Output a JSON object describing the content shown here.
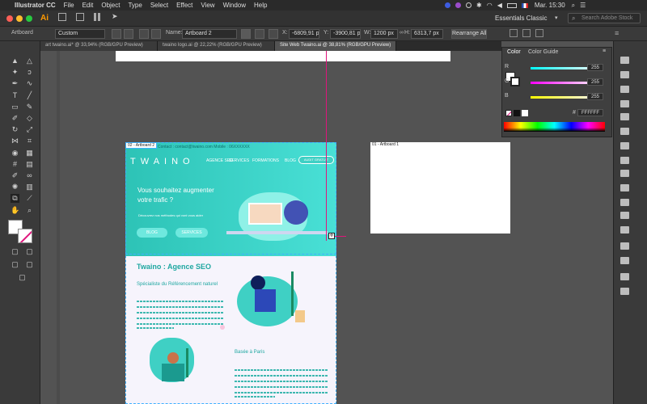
{
  "menubar": {
    "app": "Illustrator CC",
    "items": [
      "File",
      "Edit",
      "Object",
      "Type",
      "Select",
      "Effect",
      "View",
      "Window",
      "Help"
    ],
    "clock": "Mar. 15:30"
  },
  "appbar": {
    "logo": "Ai",
    "workspace": "Essentials Classic",
    "search_placeholder": "Search Adobe Stock"
  },
  "control": {
    "selection": "Artboard",
    "preset": "Custom",
    "name_label": "Name:",
    "name_value": "Artboard 2",
    "x_label": "X:",
    "x": "-6809,91 pt",
    "y_label": "Y:",
    "y": "-3900,81 pt",
    "w_label": "W:",
    "w": "1200 px",
    "h_label": "H:",
    "h": "6313,7 px",
    "rearrange": "Rearrange All"
  },
  "doc_tabs": [
    "art twaino.ai* @ 33,94% (RGB/GPU Preview)",
    "twaino logo.ai @ 22,22% (RGB/GPU Preview)",
    "Site Web Twaino.ai @ 38,81% (RGB/GPU Preview)"
  ],
  "color_panel": {
    "tabs": [
      "Color",
      "Color Guide"
    ],
    "channels": [
      {
        "label": "R",
        "value": "255",
        "color": "#e0157c"
      },
      {
        "label": "G",
        "value": "255",
        "color": "#18c8c0"
      },
      {
        "label": "B",
        "value": "255",
        "color": "#e6e000"
      }
    ],
    "hex_label": "#",
    "hex": "FFFFFF"
  },
  "artboards": {
    "artboard_2": "02 - Artboard 2",
    "artboard_1": "01 - Artboard 1"
  },
  "site": {
    "topbar": "Contact : contact@twaino.com    Mobile : 06XXXXXX",
    "logo": "TWAINO",
    "nav": [
      "AGENCE SEO",
      "SERVICES",
      "FORMATIONS",
      "BLOG"
    ],
    "audit": "AUDIT GRATUIT",
    "hero_title": "Vous souhaitez augmenter votre trafic ?",
    "hero_sub": "Découvrez nos méthodes qui vont vous aider",
    "btn1": "BLOG",
    "btn2": "SERVICES",
    "section_title": "Twaino : Agence SEO",
    "section_sub": "Spécialiste du Référencement naturel",
    "block2_title": "Basée à Paris"
  },
  "colors": {
    "teal": "#2ec9b8",
    "teal_dark": "#1fa7a1",
    "magenta": "#e0157c",
    "accent": "#e95c20"
  }
}
